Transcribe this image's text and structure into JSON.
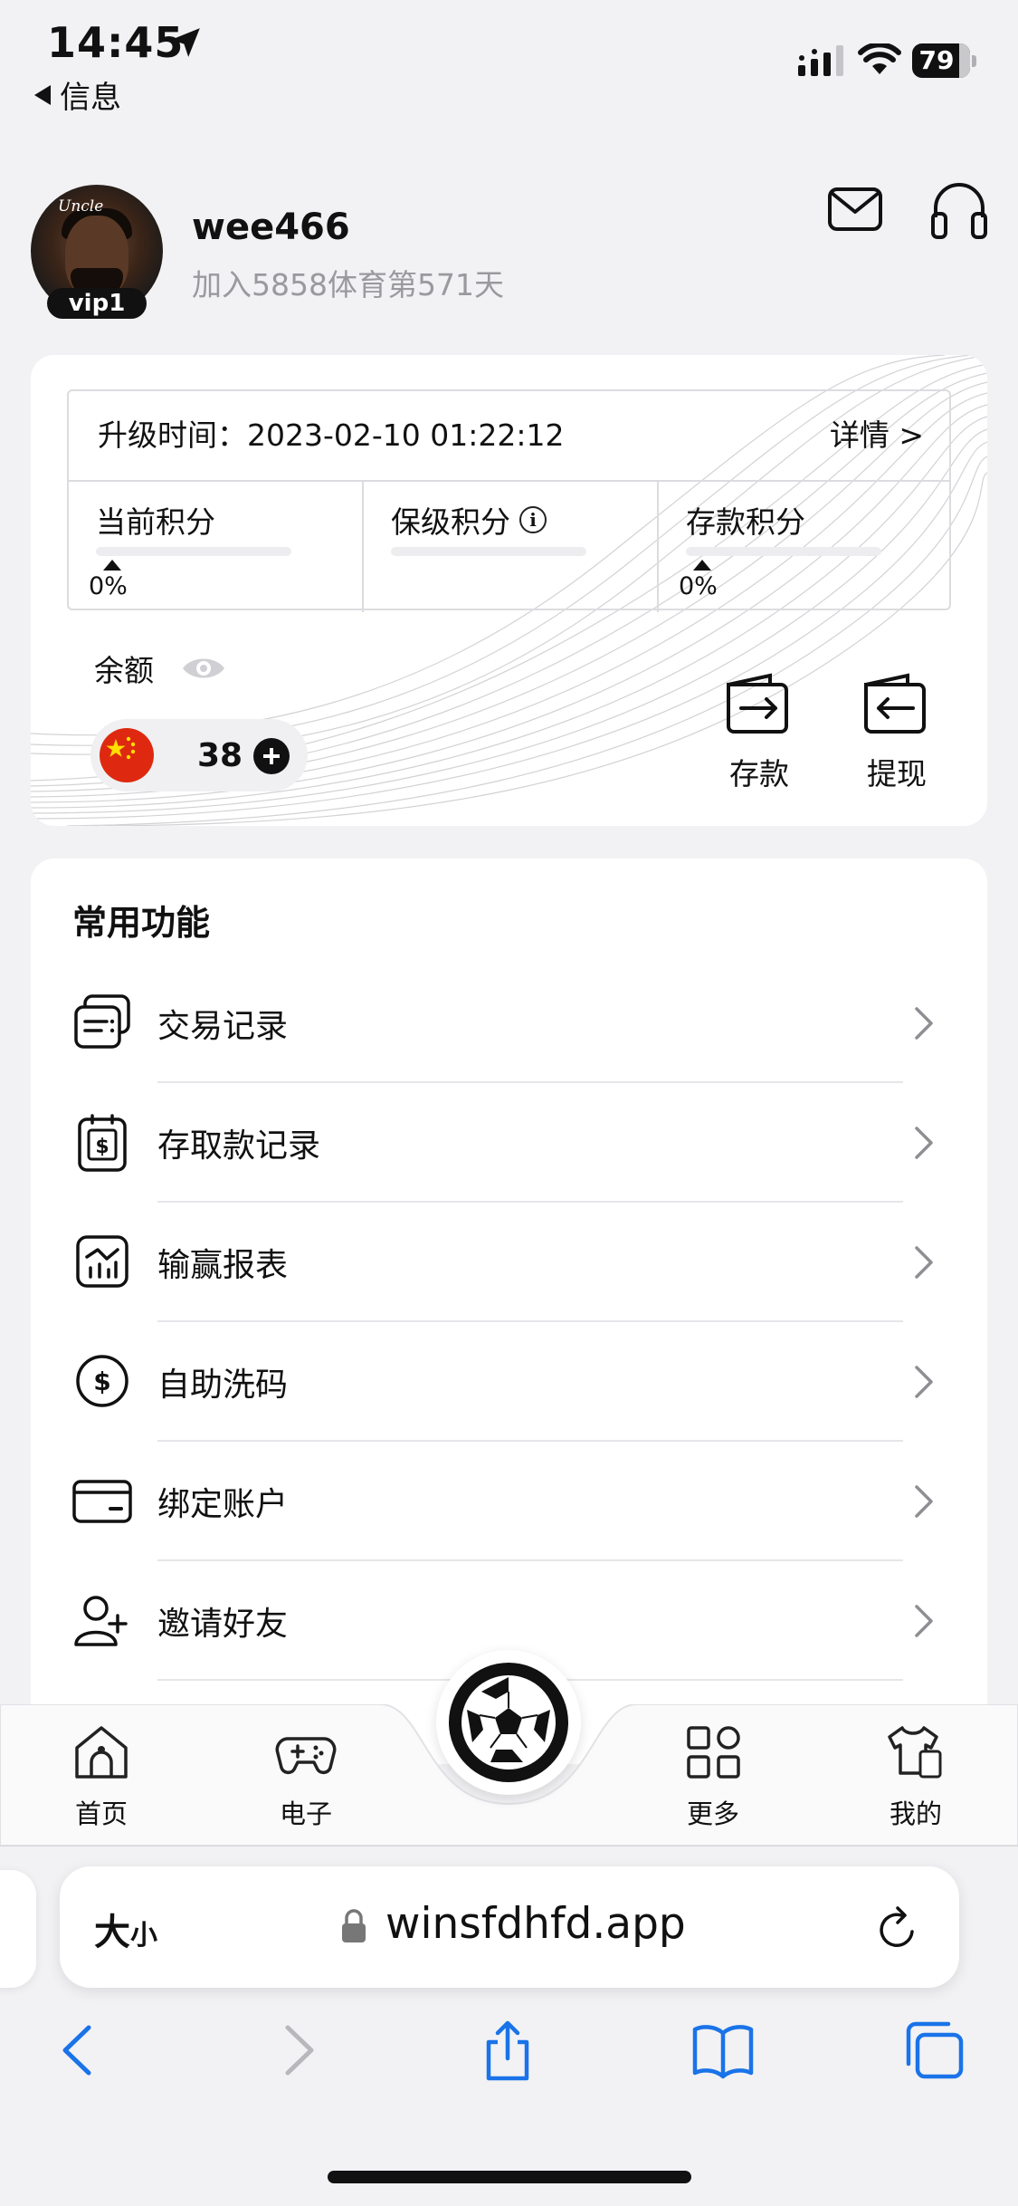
{
  "status_bar": {
    "time": "14:45",
    "back_app": "信息",
    "battery": "79"
  },
  "profile": {
    "username": "wee466",
    "join_text": "加入5858体育第571天",
    "vip_level": "vip1",
    "avatar_brand": "Uncle"
  },
  "vip_card": {
    "upgrade_label": "升级时间：2023-02-10 01:22:12",
    "detail_link": "详情 >",
    "columns": [
      {
        "label": "当前积分",
        "percent": "0%",
        "progress": 0
      },
      {
        "label": "保级积分",
        "info_glyph": "i"
      },
      {
        "label": "存款积分",
        "percent": "0%",
        "progress": 0
      }
    ],
    "balance_label": "余额",
    "balance_value": "38",
    "deposit_label": "存款",
    "withdraw_label": "提现"
  },
  "functions": {
    "title": "常用功能",
    "items": [
      {
        "label": "交易记录",
        "icon": "transaction-record-icon"
      },
      {
        "label": "存取款记录",
        "icon": "deposit-withdraw-record-icon"
      },
      {
        "label": "输赢报表",
        "icon": "win-loss-report-icon"
      },
      {
        "label": "自助洗码",
        "icon": "rebate-icon"
      },
      {
        "label": "绑定账户",
        "icon": "bank-card-icon"
      },
      {
        "label": "邀请好友",
        "icon": "invite-friend-icon"
      }
    ]
  },
  "tabbar": {
    "tabs": [
      {
        "label": "首页",
        "icon": "home-icon"
      },
      {
        "label": "电子",
        "icon": "gamepad-icon"
      },
      {
        "label": "更多",
        "icon": "grid-icon"
      },
      {
        "label": "我的",
        "icon": "clothes-icon"
      }
    ],
    "center_icon": "soccer-ball-icon"
  },
  "browser": {
    "text_size_label": "大",
    "text_size_small": "小",
    "url": "winsfdhfd.app"
  },
  "colors": {
    "background": "#f2f2f4",
    "card": "#ffffff",
    "accent_blue": "#1a73e8",
    "muted_text": "#9a9a9e"
  }
}
